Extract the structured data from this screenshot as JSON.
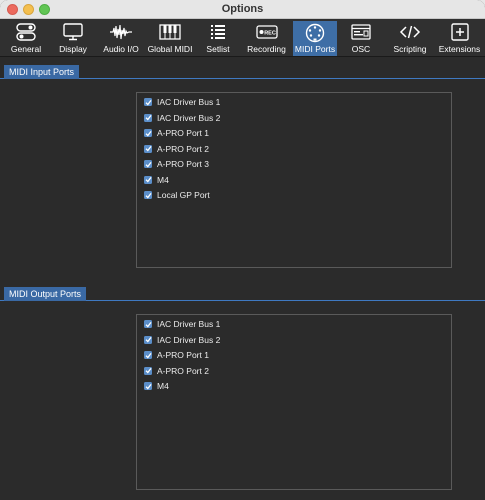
{
  "window": {
    "title": "Options"
  },
  "toolbar": {
    "tabs": [
      {
        "label": "General",
        "icon": "toggle-switches-icon",
        "active": false
      },
      {
        "label": "Display",
        "icon": "monitor-icon",
        "active": false
      },
      {
        "label": "Audio I/O",
        "icon": "waveform-icon",
        "active": false
      },
      {
        "label": "Global MIDI",
        "icon": "piano-keys-icon",
        "active": false
      },
      {
        "label": "Setlist",
        "icon": "list-icon",
        "active": false
      },
      {
        "label": "Recording",
        "icon": "rec-icon",
        "active": false
      },
      {
        "label": "MIDI Ports",
        "icon": "midi-connector-icon",
        "active": true
      },
      {
        "label": "OSC",
        "icon": "osc-window-icon",
        "active": false
      },
      {
        "label": "Scripting",
        "icon": "code-brackets-icon",
        "active": false
      },
      {
        "label": "Extensions",
        "icon": "plus-box-icon",
        "active": false
      }
    ],
    "rec_badge": "REC"
  },
  "midi_input": {
    "header": "MIDI Input Ports",
    "ports": [
      {
        "label": "IAC Driver Bus 1",
        "checked": true
      },
      {
        "label": "IAC Driver Bus 2",
        "checked": true
      },
      {
        "label": "A-PRO Port 1",
        "checked": true
      },
      {
        "label": "A-PRO Port 2",
        "checked": true
      },
      {
        "label": "A-PRO Port 3",
        "checked": true
      },
      {
        "label": "M4",
        "checked": true
      },
      {
        "label": "Local GP Port",
        "checked": true
      }
    ]
  },
  "midi_output": {
    "header": "MIDI Output Ports",
    "ports": [
      {
        "label": "IAC Driver Bus 1",
        "checked": true
      },
      {
        "label": "IAC Driver Bus 2",
        "checked": true
      },
      {
        "label": "A-PRO Port 1",
        "checked": true
      },
      {
        "label": "A-PRO Port 2",
        "checked": true
      },
      {
        "label": "M4",
        "checked": true
      }
    ]
  },
  "colors": {
    "accent": "#3e6ea6",
    "checkbox": "#5b8ec9",
    "background": "#2b2b2b"
  }
}
